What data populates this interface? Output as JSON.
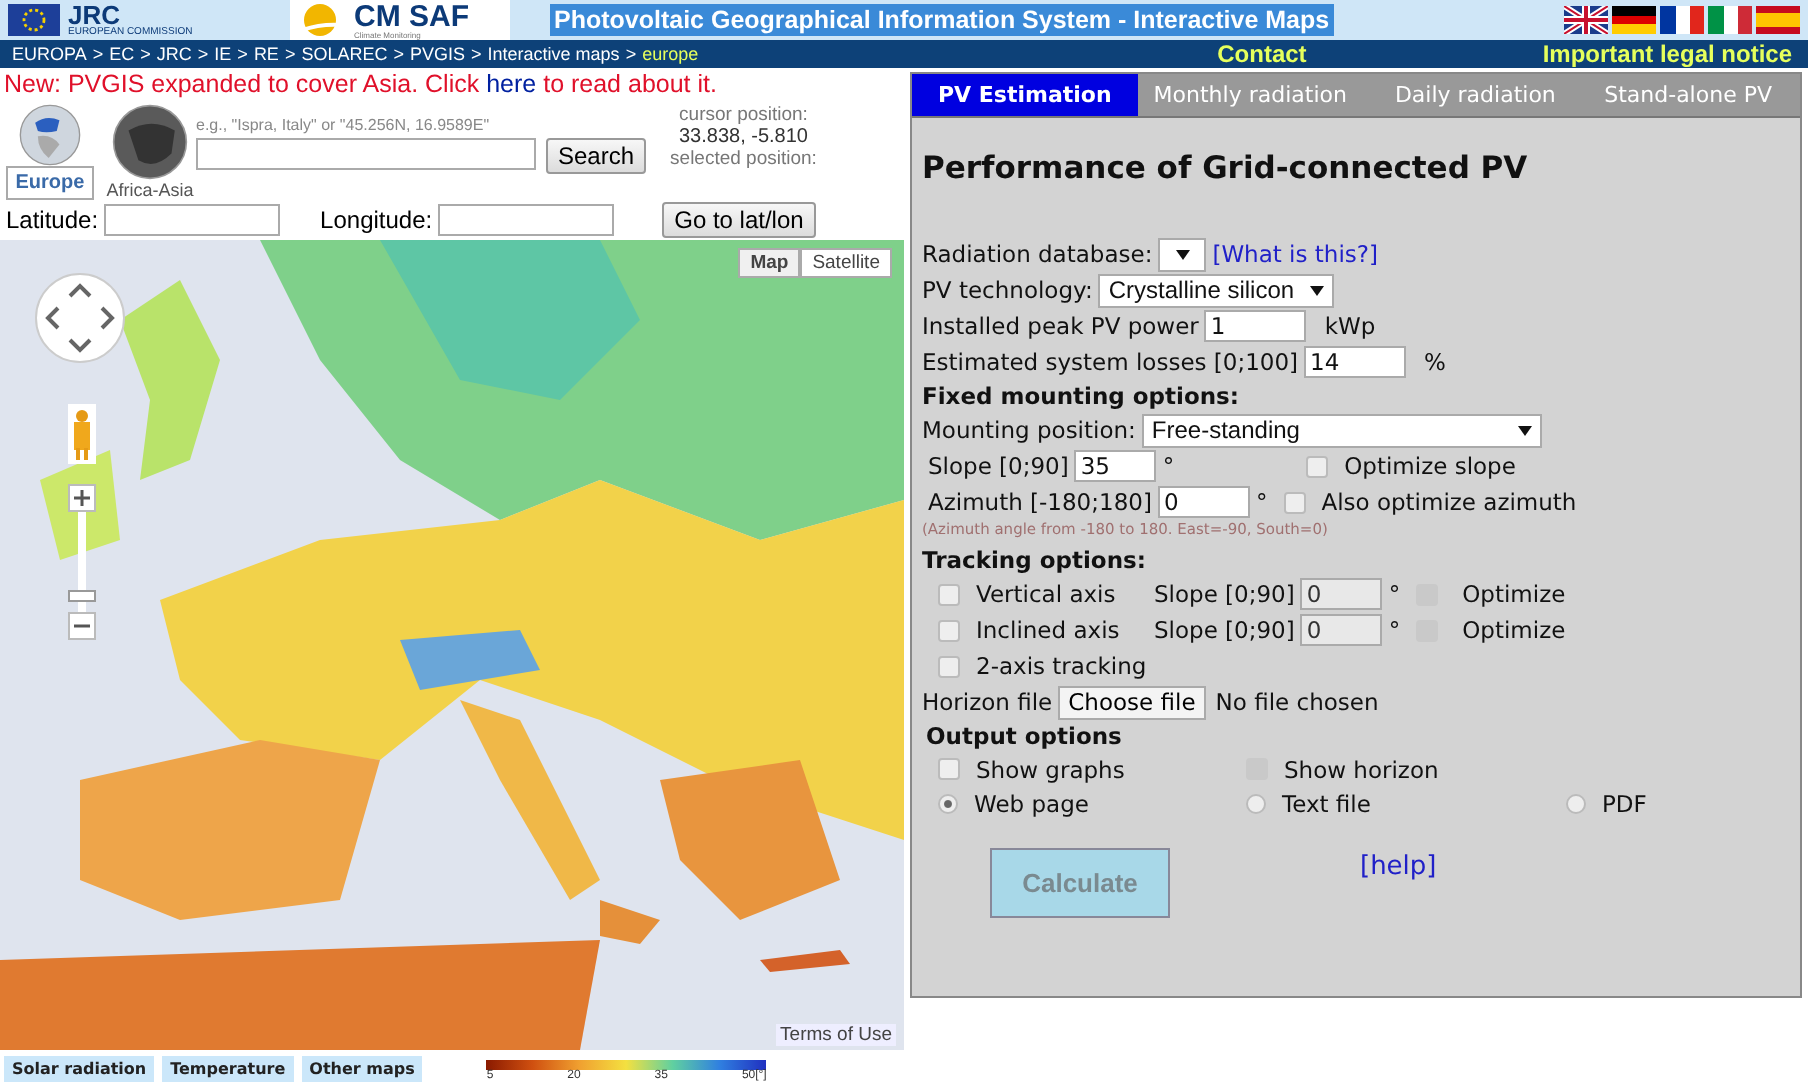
{
  "header": {
    "jrc_logo": "JRC",
    "commission": "EUROPEAN COMMISSION",
    "cmsaf_logo": "CM SAF",
    "cmsaf_sub": "Climate Monitoring",
    "title": "Photovoltaic Geographical Information System - Interactive Maps"
  },
  "breadcrumb": {
    "separator": ">",
    "items": [
      {
        "label": "EUROPA",
        "current": false
      },
      {
        "label": "EC",
        "current": false
      },
      {
        "label": "JRC",
        "current": false
      },
      {
        "label": "IE",
        "current": false
      },
      {
        "label": "RE",
        "current": false
      },
      {
        "label": "SOLAREC",
        "current": false
      },
      {
        "label": "PVGIS",
        "current": false
      },
      {
        "label": "Interactive maps",
        "current": false
      },
      {
        "label": "europe",
        "current": true
      }
    ]
  },
  "nav_links": [
    "Contact",
    "Important legal notice"
  ],
  "notice": {
    "before": "New: PVGIS expanded to cover Asia. Click ",
    "link": "here",
    "after": " to read about it."
  },
  "regions": [
    {
      "label": "Europe",
      "selected": true
    },
    {
      "label": "Africa-Asia",
      "selected": false
    }
  ],
  "search": {
    "hint": "e.g., \"Ispra, Italy\" or \"45.256N, 16.9589E\"",
    "button": "Search"
  },
  "cursor": {
    "label": "cursor position:",
    "value": "33.838, -5.810",
    "selected_label": "selected position:"
  },
  "coordinates": {
    "latitude_label": "Latitude:",
    "longitude_label": "Longitude:",
    "button": "Go to lat/lon"
  },
  "map": {
    "types": [
      {
        "label": "Map",
        "selected": true
      },
      {
        "label": "Satellite",
        "selected": false
      }
    ],
    "zoom": {
      "level": 0.1
    },
    "terms": "Terms of Use"
  },
  "map_tabs": [
    "Solar radiation",
    "Temperature",
    "Other maps"
  ],
  "legend": {
    "ticks": [
      "5",
      "20",
      "35",
      "50[°]"
    ]
  },
  "panel": {
    "tabs": [
      {
        "label": "PV Estimation",
        "selected": true
      },
      {
        "label": "Monthly radiation",
        "selected": false
      },
      {
        "label": "Daily radiation",
        "selected": false
      },
      {
        "label": "Stand-alone PV",
        "selected": false
      }
    ],
    "title": "Performance of Grid-connected PV",
    "radiation_database": {
      "label": "Radiation database:",
      "link": "[What is this?]"
    },
    "pv_technology": {
      "label": "PV technology:",
      "value": "Crystalline silicon"
    },
    "peak_power": {
      "label": "Installed peak PV power",
      "value": "1",
      "unit": "kWp"
    },
    "losses": {
      "label": "Estimated system losses [0;100]",
      "value": "14",
      "unit": "%"
    },
    "fixed_heading": "Fixed mounting options:",
    "mounting": {
      "label": "Mounting position:",
      "value": "Free-standing"
    },
    "slope": {
      "label": "Slope [0;90]",
      "value": "35",
      "unit": "°",
      "option": {
        "label": "Optimize slope",
        "checked": false
      }
    },
    "azimuth": {
      "label": "Azimuth [-180;180]",
      "value": "0",
      "unit": "°",
      "option": {
        "label": "Also optimize azimuth",
        "checked": false
      }
    },
    "azimuth_note": "(Azimuth angle from -180 to 180. East=-90, South=0)",
    "tracking_heading": "Tracking options:",
    "tracking": [
      {
        "label": "Vertical axis",
        "checked": false,
        "slope_label": "Slope [0;90]",
        "value": "0",
        "unit": "°",
        "optimize": {
          "label": "Optimize",
          "checked": false,
          "disabled": true
        }
      },
      {
        "label": "Inclined axis",
        "checked": false,
        "slope_label": "Slope [0;90]",
        "value": "0",
        "unit": "°",
        "optimize": {
          "label": "Optimize",
          "checked": false,
          "disabled": true
        }
      }
    ],
    "two_axis": {
      "label": "2-axis tracking",
      "checked": false
    },
    "horizon": {
      "label": "Horizon file",
      "button": "Choose file",
      "status": "No file chosen"
    },
    "output_heading": "Output options",
    "output_checks": [
      {
        "label": "Show graphs",
        "checked": false,
        "disabled": false
      },
      {
        "label": "Show horizon",
        "checked": false,
        "disabled": true
      }
    ],
    "output_formats": [
      {
        "label": "Web page",
        "selected": true
      },
      {
        "label": "Text file",
        "selected": false
      },
      {
        "label": "PDF",
        "selected": false
      }
    ],
    "calculate": {
      "label": "Calculate",
      "disabled": true
    },
    "help": "[help]"
  }
}
